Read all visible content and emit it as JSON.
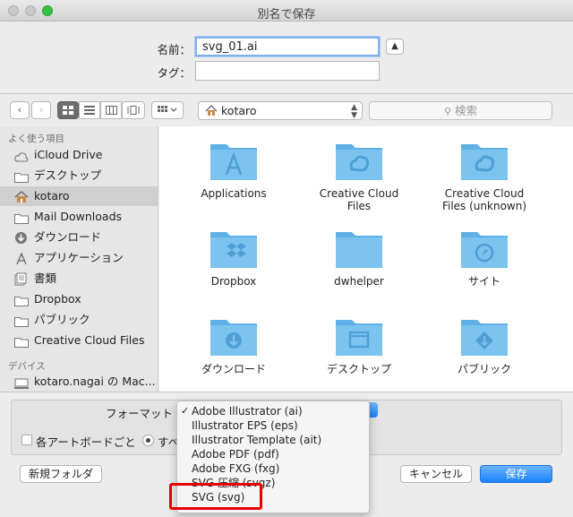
{
  "window": {
    "title": "別名で保存"
  },
  "save": {
    "name_label": "名前：",
    "name_value": "svg_01.ai",
    "tags_label": "タグ：",
    "tags_value": "",
    "expand_icon": "chevron-up-icon"
  },
  "toolbar": {
    "back_icon": "chevron-left-icon",
    "forward_icon": "chevron-right-icon",
    "view_modes": [
      "icon-view",
      "list-view",
      "column-view",
      "coverflow-view"
    ],
    "arrange_icon": "grid-arrange-icon",
    "location": "kotaro",
    "search_placeholder": "検索"
  },
  "sidebar": {
    "favorites_header": "よく使う項目",
    "favorites": [
      {
        "label": "iCloud Drive",
        "icon": "cloud-icon"
      },
      {
        "label": "デスクトップ",
        "icon": "folder-icon"
      },
      {
        "label": "kotaro",
        "icon": "home-icon",
        "selected": true
      },
      {
        "label": "Mail Downloads",
        "icon": "folder-icon"
      },
      {
        "label": "ダウンロード",
        "icon": "download-icon"
      },
      {
        "label": "アプリケーション",
        "icon": "applications-icon"
      },
      {
        "label": "書類",
        "icon": "document-icon"
      },
      {
        "label": "Dropbox",
        "icon": "folder-icon"
      },
      {
        "label": "パブリック",
        "icon": "folder-icon"
      },
      {
        "label": "Creative Cloud Files",
        "icon": "folder-icon"
      }
    ],
    "devices_header": "デバイス",
    "devices": [
      {
        "label": "kotaro.nagai の Mac...",
        "icon": "computer-icon"
      }
    ]
  },
  "files": [
    {
      "name": "Applications",
      "icon": "applications-icon"
    },
    {
      "name": "Creative Cloud Files",
      "icon": "creative-cloud-icon"
    },
    {
      "name": "Creative Cloud Files (unknown)",
      "icon": "creative-cloud-icon"
    },
    {
      "name": "Dropbox",
      "icon": "dropbox-icon"
    },
    {
      "name": "dwhelper",
      "icon": "folder-icon"
    },
    {
      "name": "サイト",
      "icon": "compass-icon"
    },
    {
      "name": "ダウンロード",
      "icon": "download-icon"
    },
    {
      "name": "デスクトップ",
      "icon": "desktop-icon"
    },
    {
      "name": "パブリック",
      "icon": "public-icon"
    }
  ],
  "options": {
    "format_label": "フォーマット",
    "artboard_checkbox_label": "各アートボードごと",
    "range_radio_label": "すべ"
  },
  "format_menu": {
    "items": [
      {
        "label": "Adobe Illustrator (ai)",
        "checked": true
      },
      {
        "label": "Illustrator EPS (eps)"
      },
      {
        "label": "Illustrator Template (ait)"
      },
      {
        "label": "Adobe PDF (pdf)"
      },
      {
        "label": "Adobe FXG (fxg)"
      },
      {
        "label": "SVG 圧縮 (svgz)"
      },
      {
        "label": "SVG (svg)",
        "highlighted": true
      }
    ]
  },
  "buttons": {
    "new_folder": "新規フォルダ",
    "cancel": "キャンセル",
    "save": "保存"
  },
  "colors": {
    "folder": "#7cc3f0",
    "primary_button": "#1a82fb",
    "highlight_box": "#e60000"
  }
}
